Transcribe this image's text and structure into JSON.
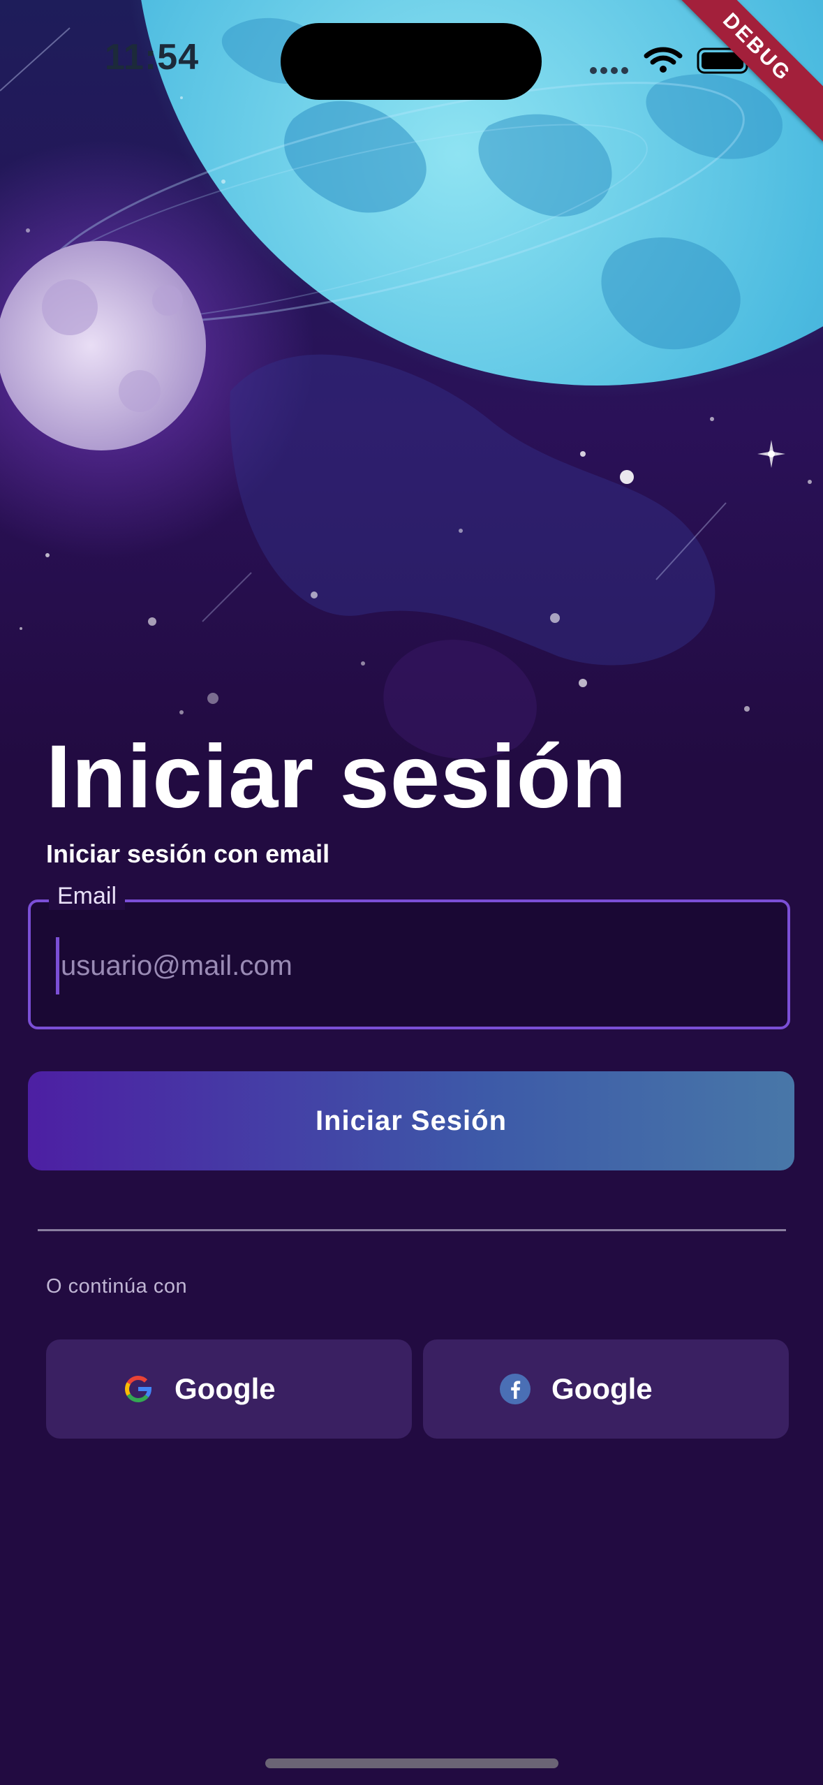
{
  "status_bar": {
    "time": "11:54"
  },
  "debug_banner": "DEBUG",
  "login": {
    "title": "Iniciar sesión",
    "subtitle": "Iniciar sesión con email",
    "email_label": "Email",
    "email_placeholder": "usuario@mail.com",
    "email_value": "",
    "submit_label": "Iniciar Sesión",
    "continue_text": "O continúa con",
    "social": {
      "google_label": "Google",
      "facebook_label": "Google"
    }
  },
  "colors": {
    "background": "#220b41",
    "accent": "#7b4fd6",
    "button_gradient_start": "#4d1fa3",
    "button_gradient_end": "#4877a8",
    "social_button": "#3a2062"
  }
}
